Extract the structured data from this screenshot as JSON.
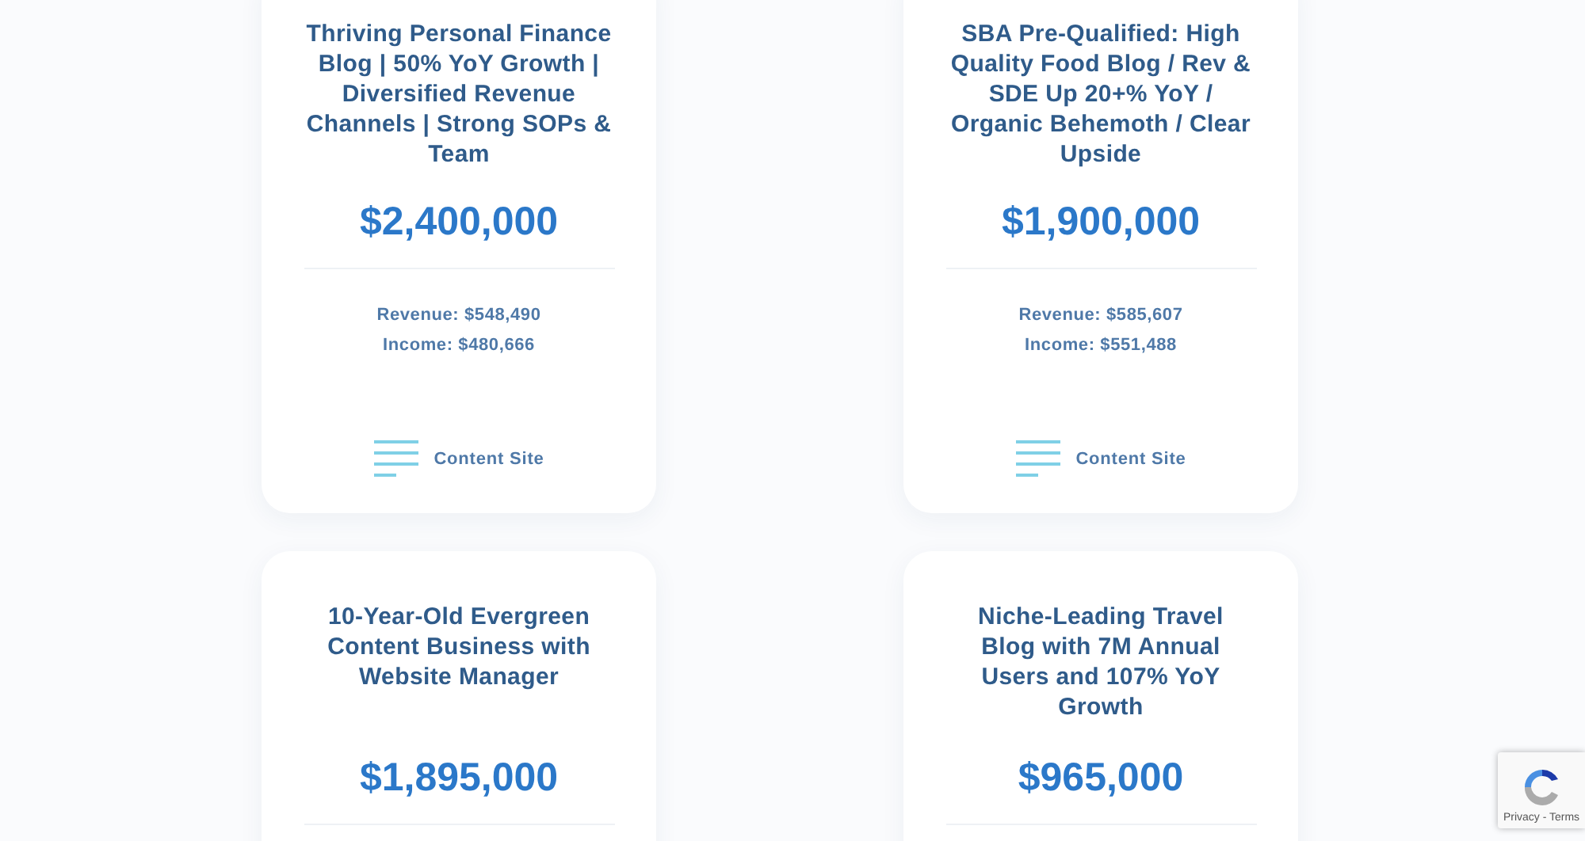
{
  "listings": [
    {
      "title": "Thriving Personal Finance Blog | 50% YoY Growth | Diversified Revenue Channels | Strong SOPs & Team",
      "price": "$2,400,000",
      "revenue": "Revenue: $548,490",
      "income": "Income: $480,666",
      "category": "Content Site"
    },
    {
      "title": "SBA Pre-Qualified: High Quality Food Blog / Rev & SDE Up 20+% YoY / Organic Behemoth / Clear Upside",
      "price": "$1,900,000",
      "revenue": "Revenue: $585,607",
      "income": "Income: $551,488",
      "category": "Content Site"
    },
    {
      "title": "10-Year-Old Evergreen Content Business with Website Manager",
      "price": "$1,895,000"
    },
    {
      "title": "Niche-Leading Travel Blog with 7M Annual Users and 107% YoY Growth",
      "price": "$965,000"
    }
  ],
  "recaptcha": {
    "links": "Privacy - Terms"
  }
}
